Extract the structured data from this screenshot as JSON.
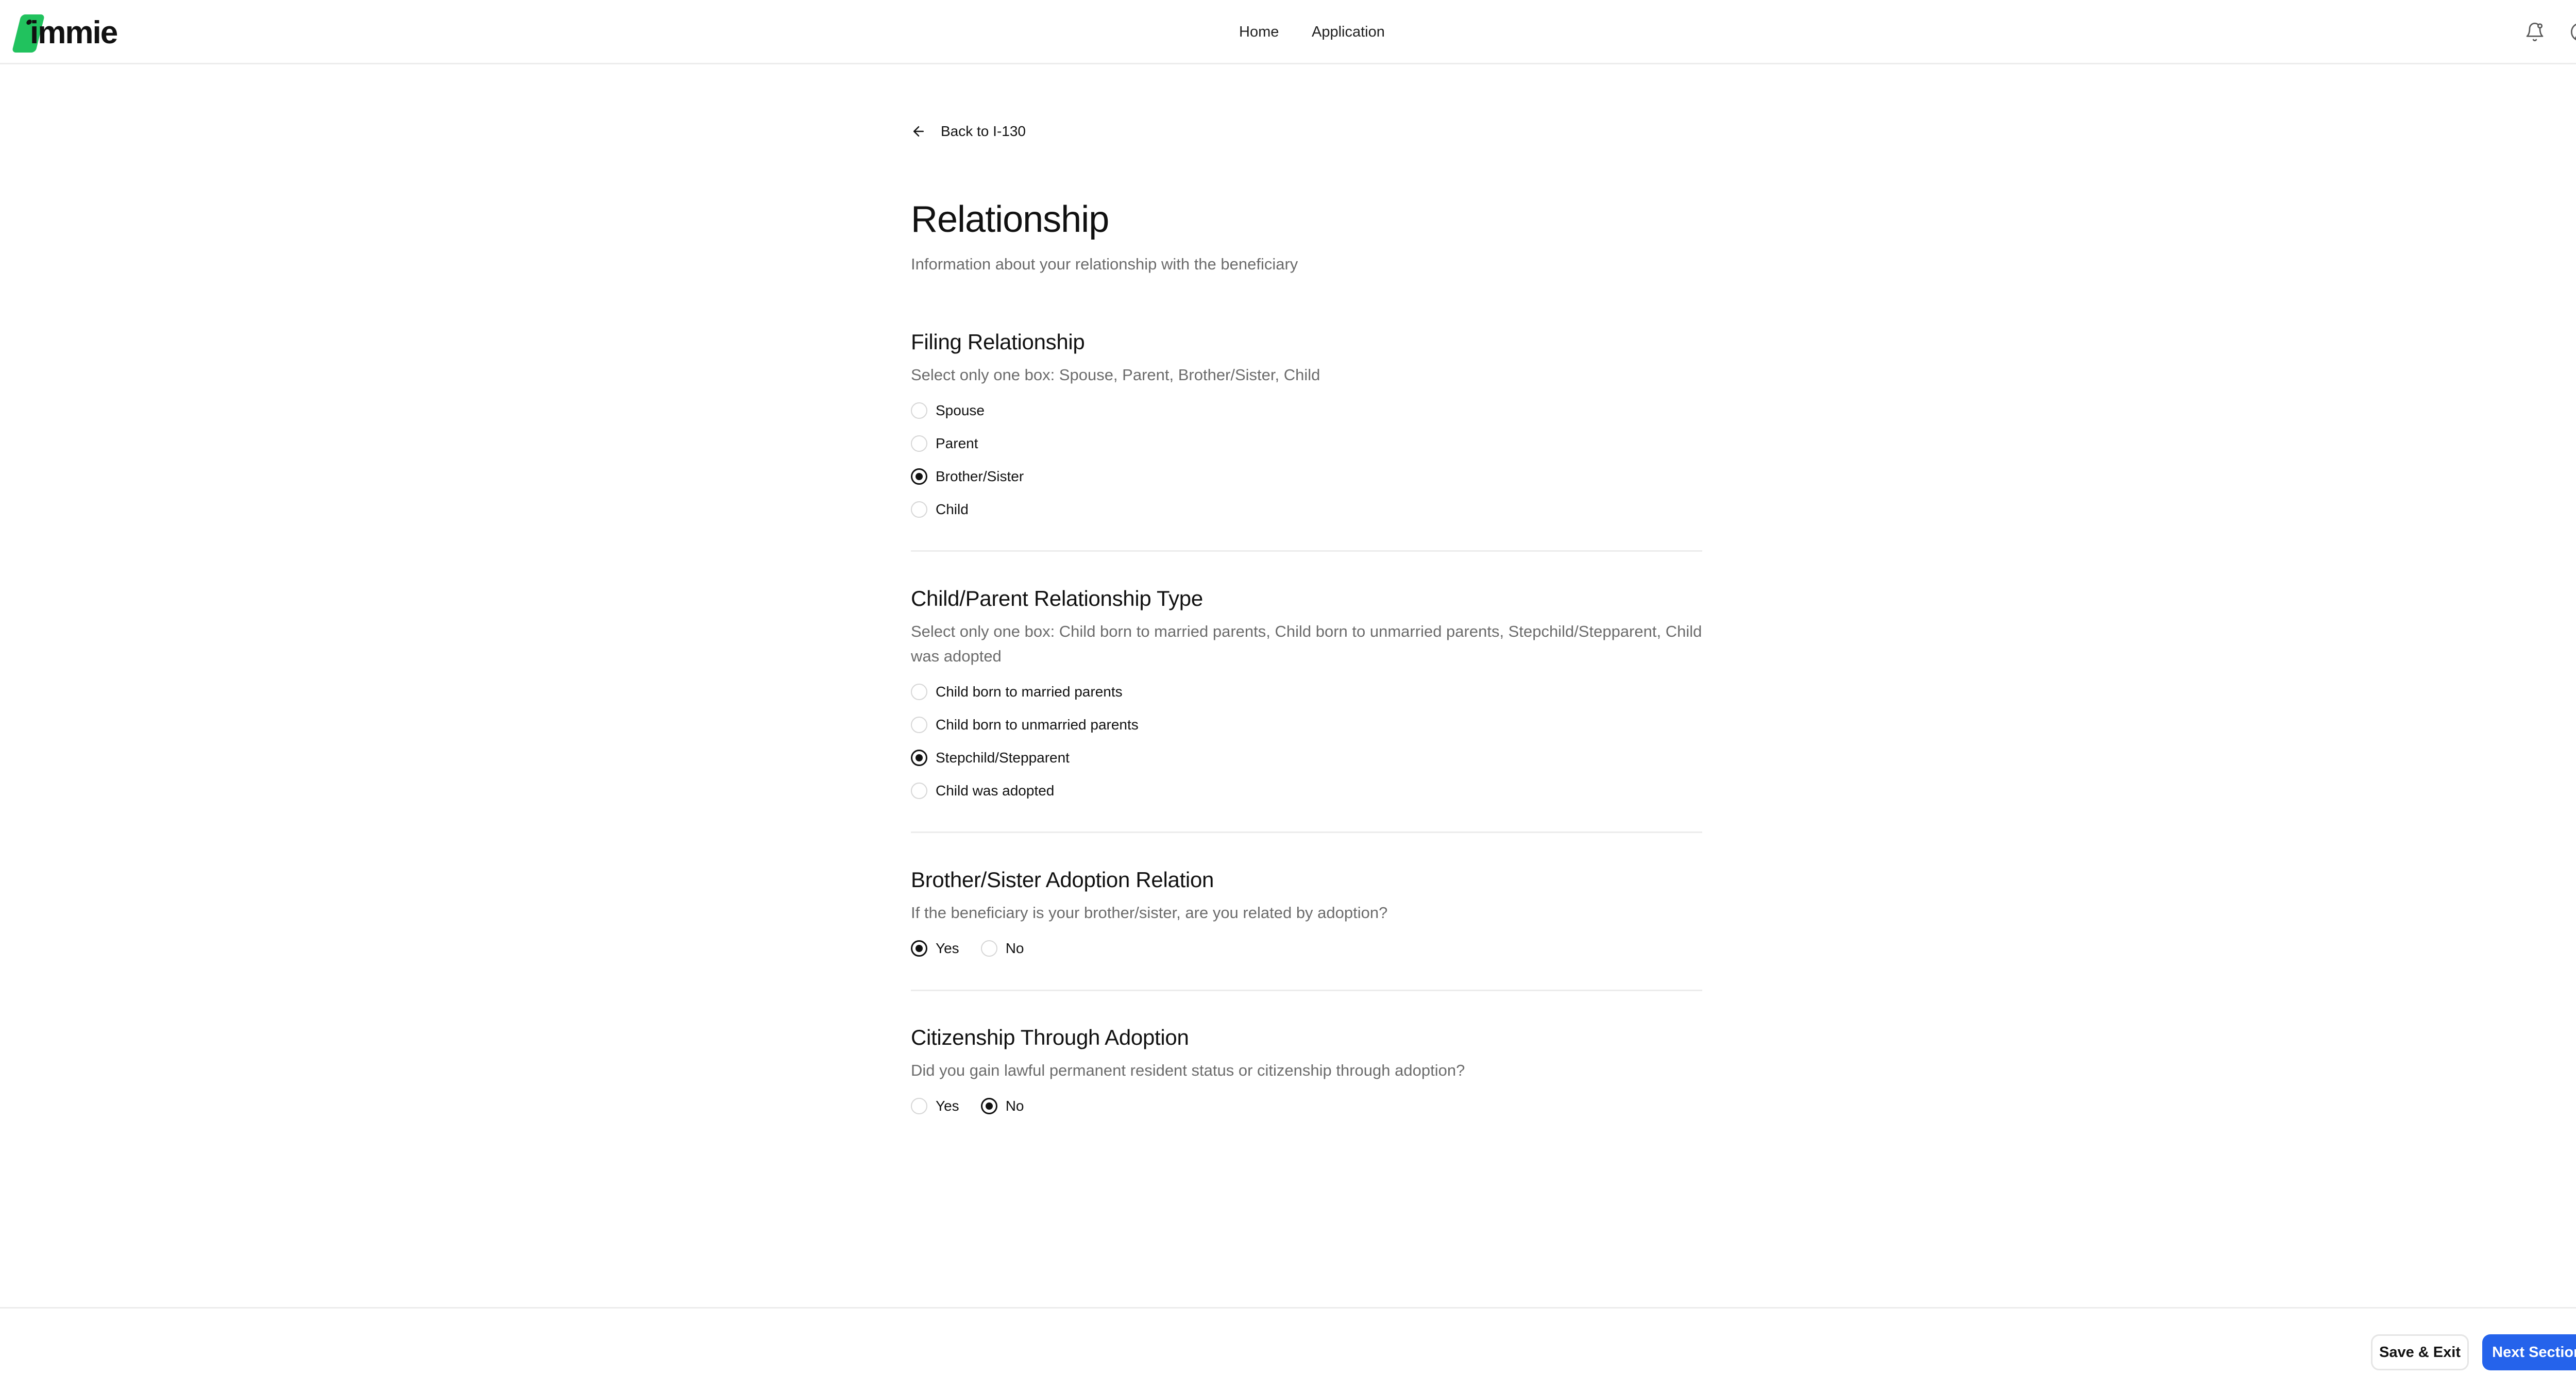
{
  "header": {
    "logo_text": "immie",
    "nav": [
      {
        "label": "Home"
      },
      {
        "label": "Application"
      }
    ],
    "icons": [
      "bell-icon",
      "user-circle-icon"
    ]
  },
  "back_link": {
    "label": "Back to I-130",
    "icon": "arrow-left-icon"
  },
  "page": {
    "title": "Relationship",
    "subtitle": "Information about your relationship with the beneficiary"
  },
  "sections": {
    "filing": {
      "title": "Filing Relationship",
      "hint": "Select only one box: Spouse, Parent, Brother/Sister, Child",
      "options": [
        "Spouse",
        "Parent",
        "Brother/Sister",
        "Child"
      ],
      "selected": "Brother/Sister"
    },
    "child_parent": {
      "title": "Child/Parent Relationship Type",
      "hint": "Select only one box: Child born to married parents, Child born to unmarried parents, Stepchild/Stepparent, Child was adopted",
      "options": [
        "Child born to married parents",
        "Child born to unmarried parents",
        "Stepchild/Stepparent",
        "Child was adopted"
      ],
      "selected": "Stepchild/Stepparent"
    },
    "sibling_adoption": {
      "title": "Brother/Sister Adoption Relation",
      "hint": "If the beneficiary is your brother/sister, are you related by adoption?",
      "options": [
        "Yes",
        "No"
      ],
      "selected": "Yes"
    },
    "citizenship_adoption": {
      "title": "Citizenship Through Adoption",
      "hint": "Did you gain lawful permanent resident status or citizenship through adoption?",
      "options": [
        "Yes",
        "No"
      ],
      "selected": "No"
    }
  },
  "footer": {
    "save_label": "Save & Exit",
    "next_label": "Next Section",
    "accent": "#2563eb"
  },
  "colors": {
    "brand_green": "#21c25e"
  }
}
